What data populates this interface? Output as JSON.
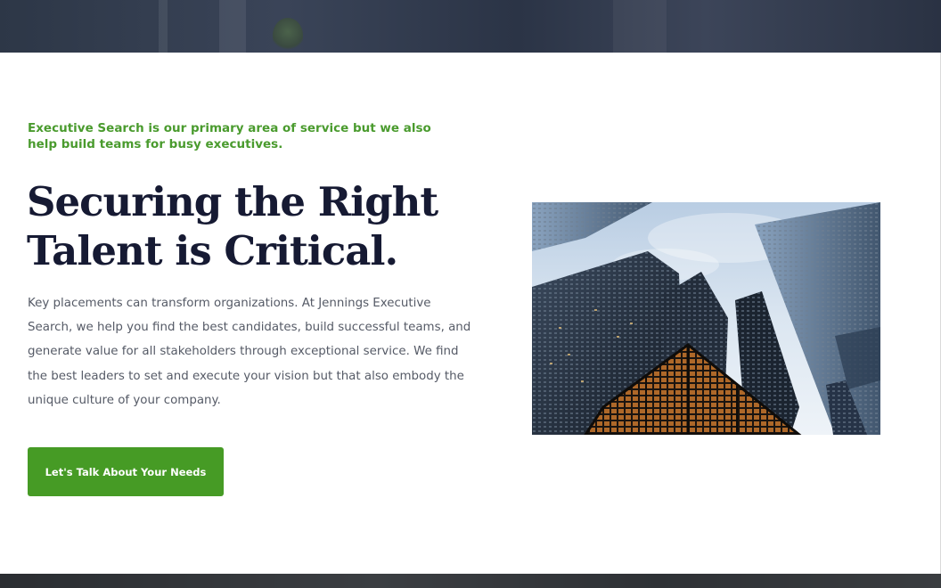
{
  "intro": {
    "kicker": "Executive Search is our primary area of service but we also help build teams for busy executives.",
    "headline_line1": "Securing the Right",
    "headline_line2": "Talent is Critical.",
    "body": "Key placements can transform organizations. At Jennings Executive Search, we help you find the best candidates, build successful teams, and generate value for all stakeholders through exceptional service. We find the best leaders to set and execute your vision but that also embody the unique culture of your company.",
    "cta_label": "Let's Talk About Your Needs"
  },
  "colors": {
    "accent_green": "#469b25",
    "kicker_green": "#4a9b2e",
    "headline_navy": "#161a33",
    "body_gray": "#555a66"
  }
}
